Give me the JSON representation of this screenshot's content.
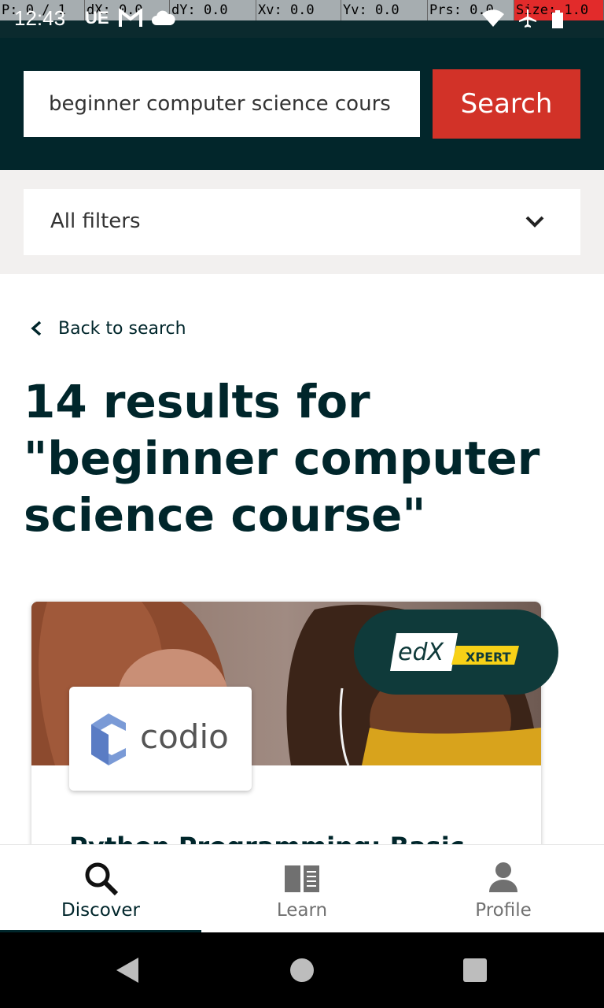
{
  "status_bar": {
    "time": "12:43",
    "debug": [
      "P: 0 / 1",
      "dX: 0.0",
      "dY: 0.0",
      "Xv: 0.0",
      "Yv: 0.0",
      "Prs: 0.0",
      "Size: 1.0"
    ],
    "left_icons": [
      "ue-icon",
      "gmail-icon",
      "cloud-icon"
    ],
    "right_icons": [
      "wifi-icon",
      "airplane-icon",
      "battery-icon"
    ]
  },
  "search": {
    "value": "beginner computer science cours",
    "button_label": "Search"
  },
  "filters": {
    "label": "All filters"
  },
  "back": {
    "label": "Back to search"
  },
  "results": {
    "heading": "14 results for \"beginner computer science course\""
  },
  "course_card": {
    "partner": "codio",
    "badge_brand": "edX",
    "badge_tag": "XPERT",
    "title": "Python Programming: Basic"
  },
  "bottom_nav": {
    "tabs": [
      {
        "label": "Discover",
        "icon": "search-icon",
        "active": true
      },
      {
        "label": "Learn",
        "icon": "book-icon",
        "active": false
      },
      {
        "label": "Profile",
        "icon": "person-icon",
        "active": false
      }
    ]
  },
  "colors": {
    "header_bg": "#02262b",
    "search_button": "#d23228",
    "filters_bg": "#f2f0ef",
    "xpert_yellow": "#f7d117"
  }
}
